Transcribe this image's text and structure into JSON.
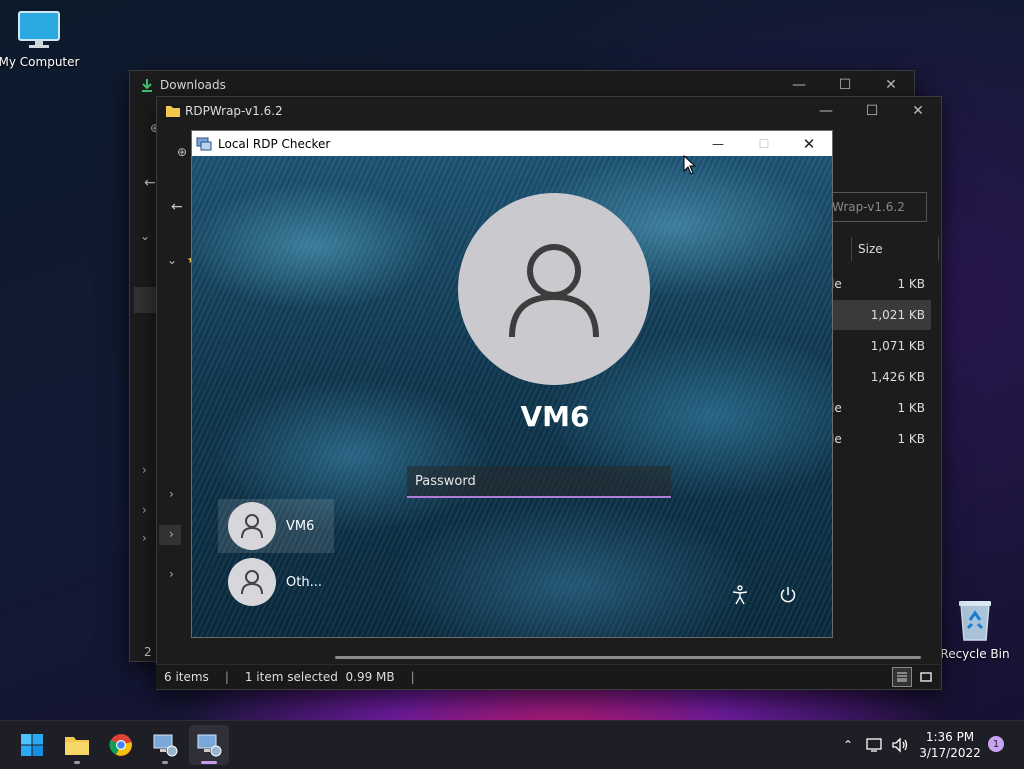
{
  "desktop": {
    "my_computer": "My Computer",
    "recycle_bin": "Recycle Bin"
  },
  "downloads_window": {
    "title": "Downloads",
    "status_count": "2 i"
  },
  "rdpwrap_window": {
    "title": "RDPWrap-v1.6.2",
    "search_value": "Wrap-v1.6.2",
    "column_size": "Size",
    "rows": [
      {
        "type_frag": "le",
        "size": "1 KB"
      },
      {
        "type_frag": "",
        "size": "1,021 KB"
      },
      {
        "type_frag": "",
        "size": "1,071 KB"
      },
      {
        "type_frag": "",
        "size": "1,426 KB"
      },
      {
        "type_frag": "le",
        "size": "1 KB"
      },
      {
        "type_frag": "le",
        "size": "1 KB"
      }
    ],
    "status": {
      "items": "6 items",
      "selected": "1 item selected  0.99 MB"
    }
  },
  "rdp_window": {
    "title": "Local RDP Checker",
    "username": "VM6",
    "password_placeholder": "Password",
    "users": [
      "VM6",
      "Oth..."
    ]
  },
  "taskbar": {
    "time": "1:36 PM",
    "date": "3/17/2022",
    "notification_count": "1"
  }
}
